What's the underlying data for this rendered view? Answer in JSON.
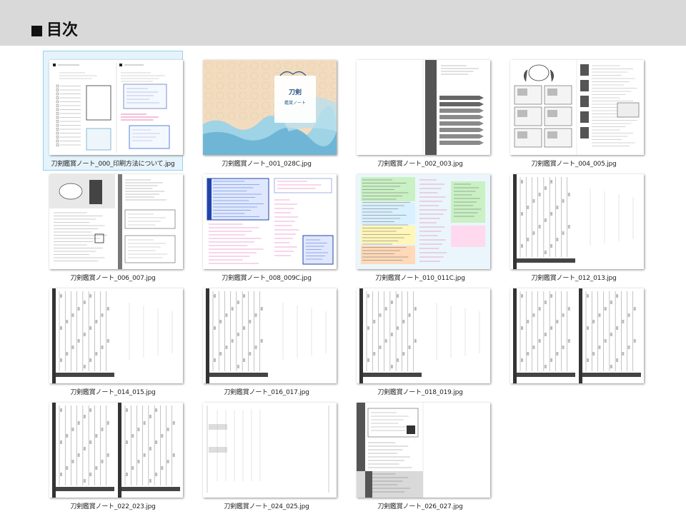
{
  "header": {
    "title": "目次"
  },
  "files": [
    {
      "name": "刀剣鑑賞ノート_000_印刷方法について.jpg",
      "kind": "howto",
      "selected": true
    },
    {
      "name": "刀剣鑑賞ノート_001_028C.jpg",
      "kind": "cover"
    },
    {
      "name": "刀剣鑑賞ノート_002_003.jpg",
      "kind": "toc"
    },
    {
      "name": "刀剣鑑賞ノート_004_005.jpg",
      "kind": "manga"
    },
    {
      "name": "刀剣鑑賞ノート_006_007.jpg",
      "kind": "guide"
    },
    {
      "name": "刀剣鑑賞ノート_008_009C.jpg",
      "kind": "blue"
    },
    {
      "name": "刀剣鑑賞ノート_010_011C.jpg",
      "kind": "color"
    },
    {
      "name": "刀剣鑑賞ノート_012_013.jpg",
      "kind": "form"
    },
    {
      "name": "刀剣鑑賞ノート_014_015.jpg",
      "kind": "form"
    },
    {
      "name": "刀剣鑑賞ノート_016_017.jpg",
      "kind": "form"
    },
    {
      "name": "刀剣鑑賞ノート_018_019.jpg",
      "kind": "form"
    },
    {
      "name": "",
      "kind": "form2"
    },
    {
      "name": "刀剣鑑賞ノート_022_023.jpg",
      "kind": "form2"
    },
    {
      "name": "刀剣鑑賞ノート_024_025.jpg",
      "kind": "sparse"
    },
    {
      "name": "刀剣鑑賞ノート_026_027.jpg",
      "kind": "back"
    }
  ],
  "cover": {
    "title_line1": "刀剣",
    "title_line2": "鑑賞ノート"
  }
}
